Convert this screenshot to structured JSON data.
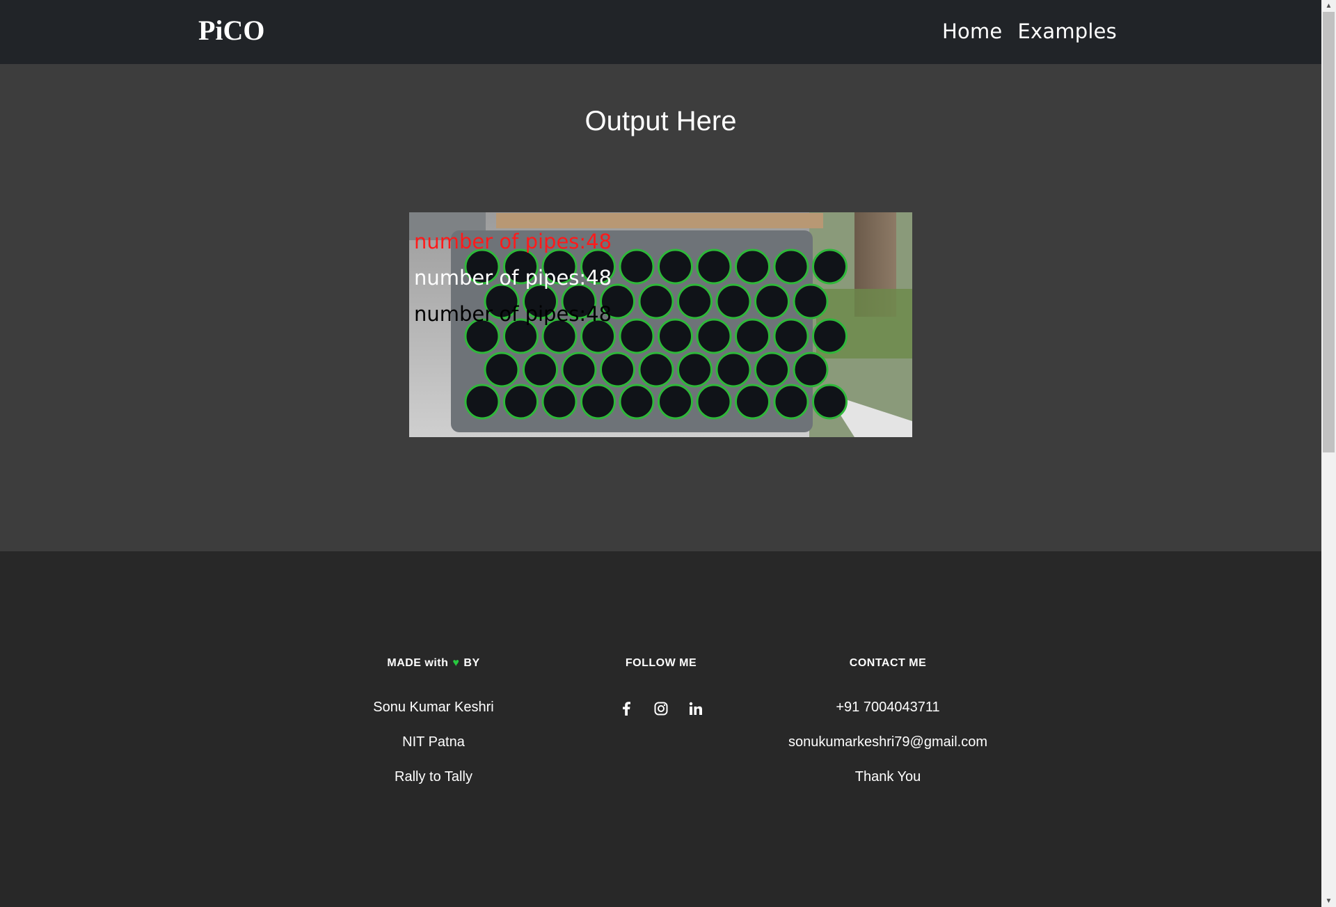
{
  "header": {
    "brand": "PiCO",
    "nav": [
      {
        "label": "Home"
      },
      {
        "label": "Examples"
      }
    ]
  },
  "main": {
    "title": "Output Here",
    "image": {
      "overlay_lines": [
        {
          "text": "number of pipes:48",
          "color": "#ff1a1a"
        },
        {
          "text": "number of pipes:48",
          "color": "#ffffff"
        },
        {
          "text": "number of pipes:48",
          "color": "#000000"
        }
      ],
      "pipe_ring_color": "#2fb83a"
    }
  },
  "footer": {
    "made": {
      "heading_pre": "MADE with",
      "heading_post": "BY",
      "heart_icon": "heart-icon",
      "heart_color": "#27c93f",
      "items": [
        "Sonu Kumar Keshri",
        "NIT Patna",
        "Rally to Tally"
      ]
    },
    "follow": {
      "heading": "FOLLOW ME",
      "icons": [
        "facebook-icon",
        "instagram-icon",
        "linkedin-icon"
      ]
    },
    "contact": {
      "heading": "CONTACT ME",
      "items": [
        "+91 7004043711",
        "sonukumarkeshri79@gmail.com",
        "Thank You"
      ]
    }
  },
  "colors": {
    "topbar": "#212428",
    "main_bg": "#3d3d3d",
    "footer_bg": "#282828"
  }
}
